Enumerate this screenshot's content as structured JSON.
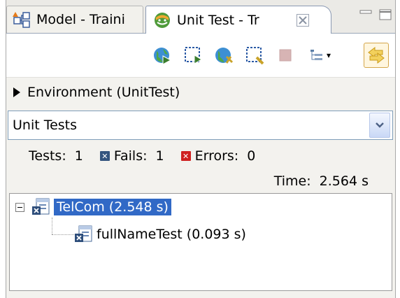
{
  "tabs": [
    {
      "label": "Model - Traini",
      "icon": "model-icon",
      "active": false
    },
    {
      "label": "Unit Test - Tr",
      "icon": "unit-test-icon",
      "active": true,
      "close_glyph": "☒"
    }
  ],
  "window_controls": {
    "minimize": "minimize-icon",
    "maximize": "maximize-icon"
  },
  "toolbar": {
    "buttons": [
      "run-globe-icon",
      "run-select-icon",
      "debug-globe-icon",
      "debug-select-icon",
      "stop-icon",
      "layout-icon",
      "history-icon"
    ]
  },
  "environment": {
    "label": "Environment (UnitTest)"
  },
  "suite_combo": {
    "value": "Unit Tests"
  },
  "stats": {
    "tests_label": "Tests:",
    "tests_value": "1",
    "fails_label": "Fails:",
    "fails_value": "1",
    "errors_label": "Errors:",
    "errors_value": "0",
    "fails_badge": "✕",
    "errors_badge": "✕"
  },
  "time": {
    "label": "Time:",
    "value": "2.564 s"
  },
  "tree": {
    "root": {
      "label": "TelCom (2.548 s)",
      "expanded": true,
      "selected": true
    },
    "children": [
      {
        "label": "fullNameTest (0.093 s)"
      }
    ]
  },
  "colors": {
    "selection": "#3169c6",
    "fail": "#33547e",
    "error": "#cf2020"
  }
}
